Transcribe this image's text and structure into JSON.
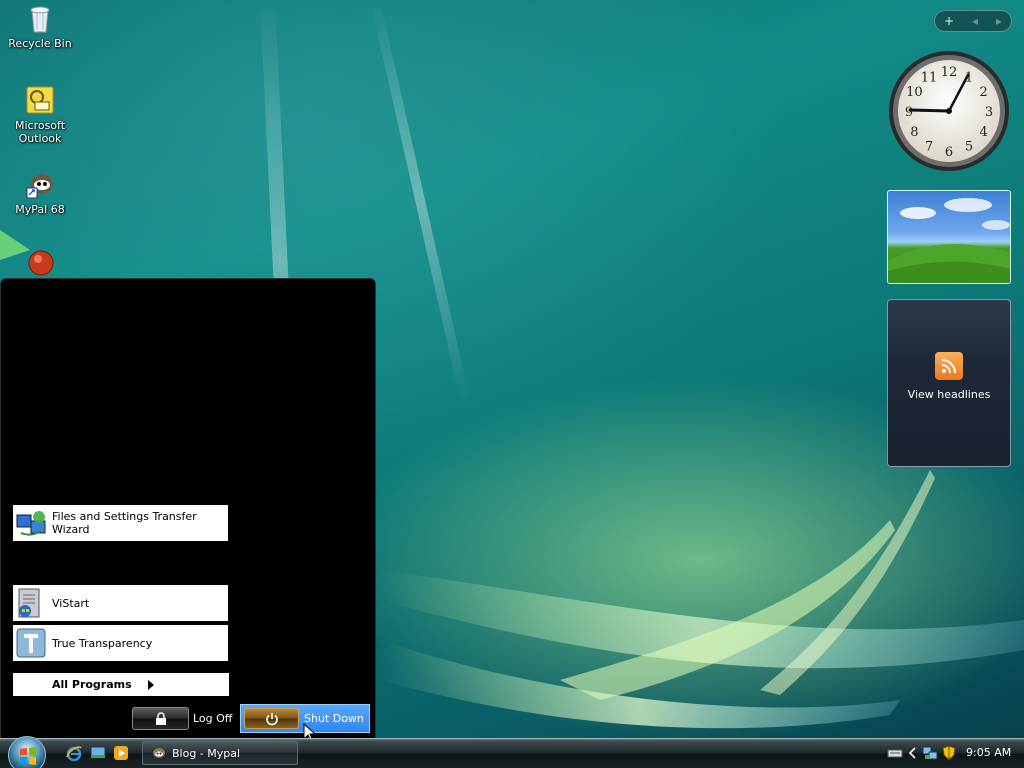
{
  "desktop": {
    "icons": [
      {
        "label": "Recycle Bin",
        "icon": "recycle-bin-icon"
      },
      {
        "label": "Microsoft Outlook",
        "icon": "outlook-icon"
      },
      {
        "label": "MyPal 68",
        "icon": "mypal-icon"
      },
      {
        "label": "",
        "icon": "red-orb-app-icon"
      }
    ]
  },
  "gadgets": {
    "controls": [
      "+",
      "◂",
      "▸"
    ],
    "clock": {
      "numerals": [
        "12",
        "1",
        "2",
        "3",
        "4",
        "5",
        "6",
        "7",
        "8",
        "9",
        "10",
        "11"
      ],
      "time": "9:05"
    },
    "feed": {
      "label": "View headlines",
      "icon": "rss-icon"
    }
  },
  "start_menu": {
    "items": [
      {
        "label": "Files and Settings Transfer Wizard",
        "icon": "transfer-wizard-icon"
      },
      {
        "label": "ViStart",
        "icon": "vistart-icon"
      },
      {
        "label": "True Transparency",
        "icon": "true-transparency-icon"
      }
    ],
    "all_programs": "All Programs",
    "log_off": "Log Off",
    "shut_down": "Shut Down"
  },
  "taskbar": {
    "quick_launch": [
      "internet-explorer-icon",
      "show-desktop-icon",
      "media-player-icon"
    ],
    "task_button": "Blog - Mypal",
    "tray": [
      "chevron-left-icon",
      "network-icon",
      "security-shield-icon"
    ],
    "clock": "9:05 AM"
  },
  "colors": {
    "start_menu_bg": "#000000",
    "shutdown_highlight": "#3a8ff2",
    "power_button": "#7a5515"
  }
}
